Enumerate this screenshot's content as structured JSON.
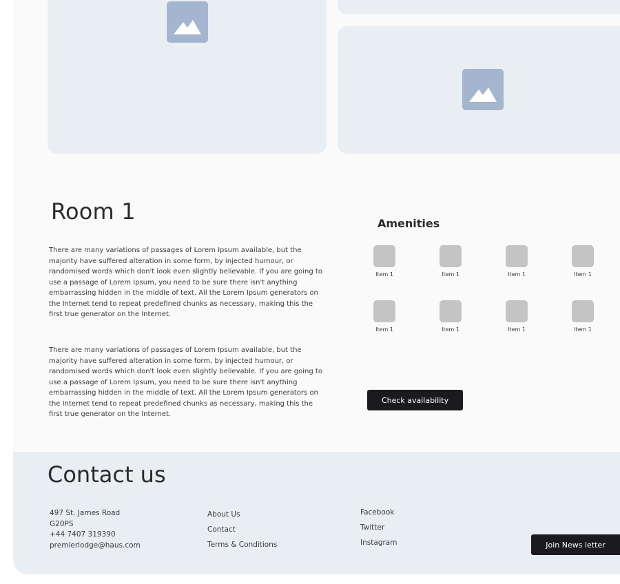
{
  "room": {
    "title": "Room 1",
    "description": [
      "There are many variations of passages of Lorem Ipsum available, but the majority have suffered alteration in some form, by injected humour, or randomised words which don't look even slightly believable. If you are going to use a passage of Lorem Ipsum, you need to be sure there isn't anything embarrassing hidden in the middle of text. All the Lorem Ipsum generators on the Internet tend to repeat predefined chunks as necessary, making this the first true generator on the Internet.",
      "There are many variations of passages of Lorem Ipsum available, but the majority have suffered alteration in some form, by injected humour, or randomised words which don't look even slightly believable. If you are going to use a passage of Lorem Ipsum, you need to be sure there isn't anything embarrassing hidden in the middle of text. All the Lorem Ipsum generators on the Internet tend to repeat predefined chunks as necessary, making this the first true generator on the Internet."
    ]
  },
  "amenities": {
    "title": "Amenities",
    "items": [
      {
        "label": "Item 1"
      },
      {
        "label": "Item 1"
      },
      {
        "label": "Item 1"
      },
      {
        "label": "Item 1"
      },
      {
        "label": "Item 1"
      },
      {
        "label": "Item 1"
      },
      {
        "label": "Item 1"
      },
      {
        "label": "Item 1"
      }
    ],
    "check_label": "Check availability"
  },
  "contact": {
    "title": "Contact us",
    "address": [
      "497 St. James Road",
      "G20PS",
      "+44 7407 319390",
      "premierlodge@haus.com"
    ],
    "site_links": [
      "About Us",
      "Contact",
      "Terms & Conditions"
    ],
    "social_links": [
      "Facebook",
      "Twitter",
      "Instagram"
    ],
    "newsletter_label": "Join News letter"
  },
  "icons": {
    "image_placeholder": "image-placeholder-icon"
  },
  "colors": {
    "page_bg": "#fafafa",
    "placeholder_bg": "#e9eef3",
    "placeholder_icon": "#a4b6cf",
    "amenity_tile": "#c4c4c4",
    "button_bg": "#1b1b1f",
    "button_text": "#ffffff"
  }
}
